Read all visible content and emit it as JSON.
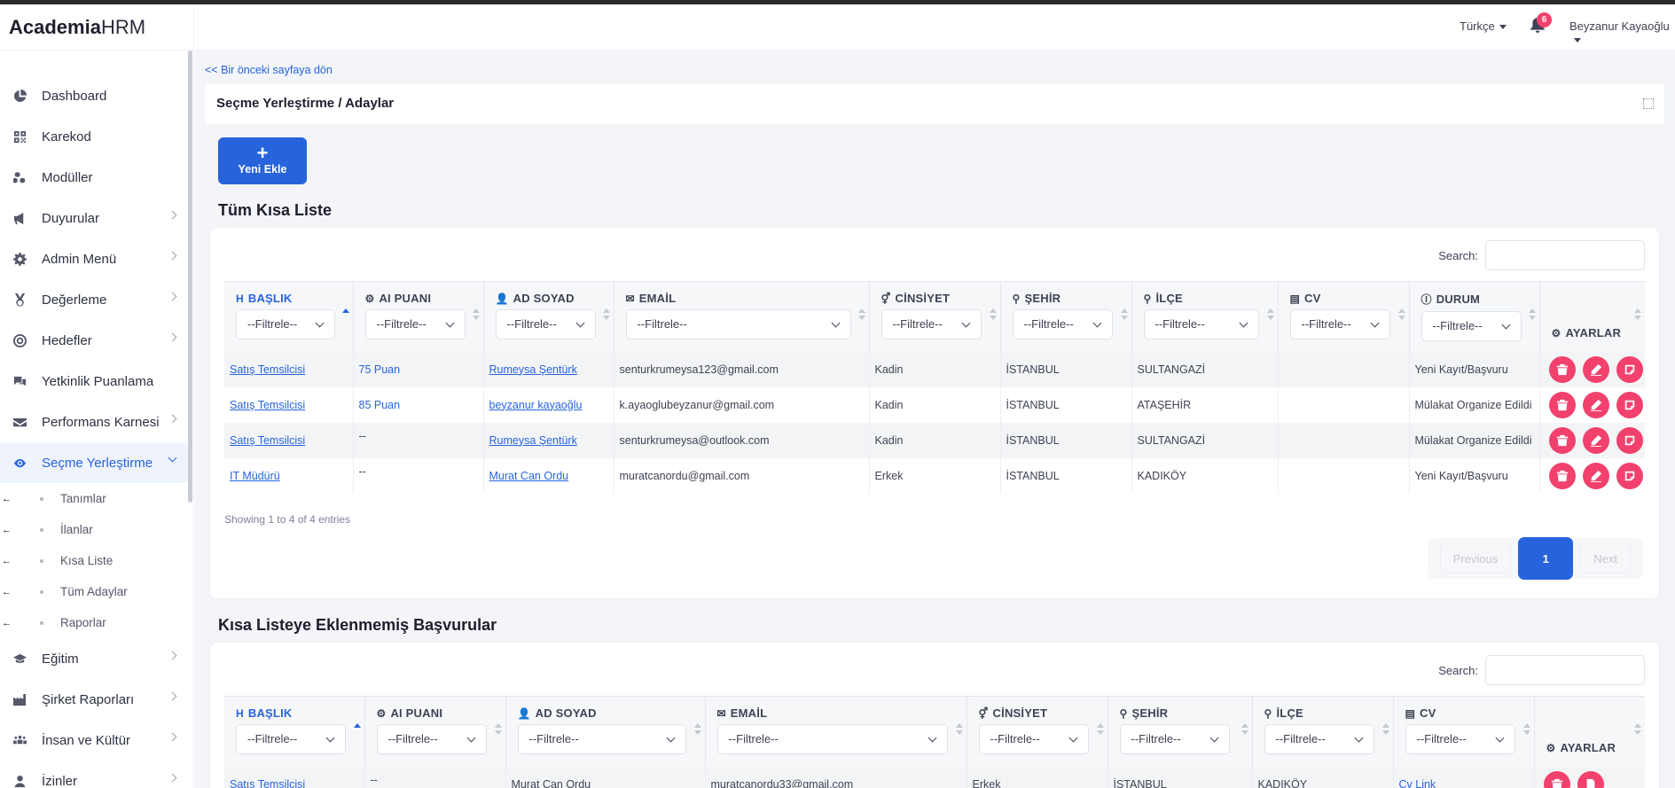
{
  "brand": {
    "bold": "Academia",
    "light": "HRM"
  },
  "header": {
    "language": "Türkçe",
    "notification_count": "6",
    "user_name": "Beyzanur Kayaoğlu"
  },
  "sidebar": {
    "items": [
      {
        "label": "Dashboard",
        "icon": "pie-chart-icon"
      },
      {
        "label": "Karekod",
        "icon": "qrcode-icon"
      },
      {
        "label": "Modüller",
        "icon": "cubes-icon"
      },
      {
        "label": "Duyurular",
        "icon": "megaphone-icon"
      },
      {
        "label": "Admin Menü",
        "icon": "gear-icon"
      },
      {
        "label": "Değerleme",
        "icon": "medal-icon"
      },
      {
        "label": "Hedefler",
        "icon": "target-icon"
      },
      {
        "label": "Yetkinlik Puanlama",
        "icon": "comments-icon"
      },
      {
        "label": "Performans Karnesi",
        "icon": "envelope-icon"
      },
      {
        "label": "Seçme Yerleştirme",
        "icon": "eye-icon"
      },
      {
        "label": "Eğitim",
        "icon": "graduation-cap-icon"
      },
      {
        "label": "Şirket Raporları",
        "icon": "industry-icon"
      },
      {
        "label": "İnsan ve Kültür",
        "icon": "people-icon"
      },
      {
        "label": "İzinler",
        "icon": "user-icon"
      }
    ],
    "subitems": [
      "Tanımlar",
      "İlanlar",
      "Kısa Liste",
      "Tüm Adaylar",
      "Raporlar"
    ]
  },
  "page": {
    "back_link": "<< Bir önceki sayfaya dön",
    "title": "Seçme Yerleştirme / Adaylar",
    "add_button": "Yeni Ekle"
  },
  "shortlist": {
    "title": "Tüm Kısa Liste",
    "search_label": "Search:",
    "filter_placeholder": "--Filtrele--",
    "columns": [
      "BAŞLIK",
      "AI PUANI",
      "AD SOYAD",
      "EMAİL",
      "CİNSİYET",
      "ŞEHİR",
      "İLÇE",
      "CV",
      "DURUM",
      "AYARLAR"
    ],
    "rows": [
      {
        "title": "Satış Temsilcisi",
        "score": "75 Puan",
        "name": "Rumeysa Şentürk",
        "email": "senturkrumeysa123@gmail.com",
        "gender": "Kadin",
        "city": "İSTANBUL",
        "district": "SULTANGAZİ",
        "cv": "",
        "status": "Yeni Kayıt/Başvuru"
      },
      {
        "title": "Satış Temsilcisi",
        "score": "85 Puan",
        "name": "beyzanur kayaoğlu",
        "email": "k.ayaoglubeyzanur@gmail.com",
        "gender": "Kadin",
        "city": "İSTANBUL",
        "district": "ATAŞEHİR",
        "cv": "",
        "status": "Mülakat Organize Edildi"
      },
      {
        "title": "Satış Temsilcisi",
        "score": "--",
        "name": "Rumeysa Şentürk",
        "email": "senturkrumeysa@outlook.com",
        "gender": "Kadin",
        "city": "İSTANBUL",
        "district": "SULTANGAZİ",
        "cv": "",
        "status": "Mülakat Organize Edildi"
      },
      {
        "title": "IT Müdürü",
        "score": "--",
        "name": "Murat Can Ordu",
        "email": "muratcanordu@gmail.com",
        "gender": "Erkek",
        "city": "İSTANBUL",
        "district": "KADIKÖY",
        "cv": "",
        "status": "Yeni Kayıt/Başvuru"
      }
    ],
    "info": "Showing 1 to 4 of 4 entries",
    "pagination": {
      "previous": "Previous",
      "current": "1",
      "next": "Next"
    }
  },
  "unlisted": {
    "title": "Kısa Listeye Eklenmemiş Başvurular",
    "search_label": "Search:",
    "filter_placeholder": "--Filtrele--",
    "columns": [
      "BAŞLIK",
      "AI PUANI",
      "AD SOYAD",
      "EMAİL",
      "CİNSİYET",
      "ŞEHİR",
      "İLÇE",
      "CV",
      "AYARLAR"
    ],
    "rows": [
      {
        "title": "Satış Temsilcisi",
        "score": "--",
        "name": "Murat Can Ordu",
        "email": "muratcanordu33@gmail.com",
        "gender": "Erkek",
        "city": "İSTANBUL",
        "district": "KADIKÖY",
        "cv": "Cv Link"
      }
    ]
  },
  "colors": {
    "accent": "#2764db",
    "danger": "#f1416c",
    "page_bg": "#f3f5f8"
  }
}
